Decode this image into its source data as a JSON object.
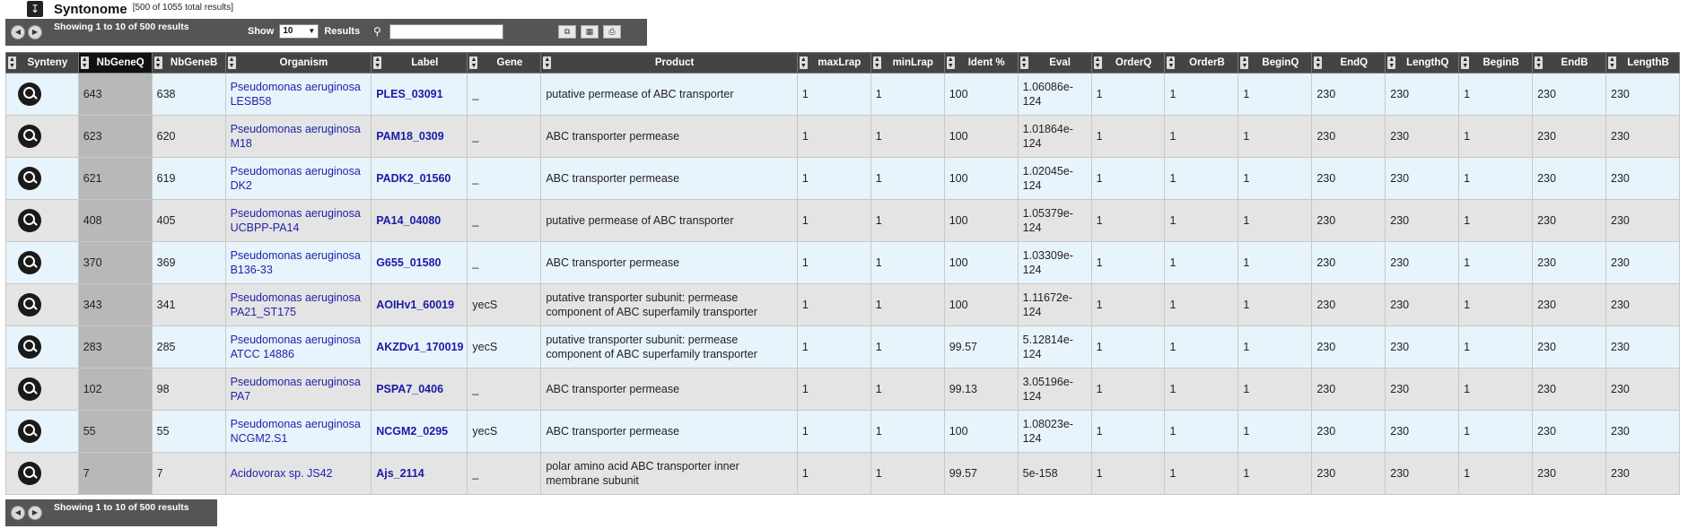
{
  "header": {
    "collapse_icon": "download-arrow-icon",
    "title": "Syntonome",
    "total": "[500 of 1055 total results]"
  },
  "toolbar": {
    "showing": "Showing 1 to 10 of 500 results",
    "show_label": "Show",
    "show_value": "10",
    "results_label": "Results",
    "search_placeholder": ""
  },
  "footer": {
    "showing": "Showing 1 to 10 of 500 results"
  },
  "columns": [
    "Synteny",
    "NbGeneQ",
    "NbGeneB",
    "Organism",
    "Label",
    "Gene",
    "Product",
    "maxLrap",
    "minLrap",
    "Ident %",
    "Eval",
    "OrderQ",
    "OrderB",
    "BeginQ",
    "EndQ",
    "LengthQ",
    "BeginB",
    "EndB",
    "LengthB"
  ],
  "rows": [
    {
      "nbq": "643",
      "nbb": "638",
      "org1": "Pseudomonas aeruginosa",
      "org2": "LESB58",
      "label": "PLES_03091",
      "gene": "_",
      "product": "putative permease of ABC transporter",
      "maxl": "1",
      "minl": "1",
      "ident": "100",
      "eval1": "1.06086e-",
      "eval2": "124",
      "oq": "1",
      "ob": "1",
      "bq": "1",
      "eq": "230",
      "lq": "230",
      "bb": "1",
      "eb": "230",
      "lb": "230"
    },
    {
      "nbq": "623",
      "nbb": "620",
      "org1": "Pseudomonas aeruginosa",
      "org2": "M18",
      "label": "PAM18_0309",
      "gene": "_",
      "product": "ABC transporter permease",
      "maxl": "1",
      "minl": "1",
      "ident": "100",
      "eval1": "1.01864e-",
      "eval2": "124",
      "oq": "1",
      "ob": "1",
      "bq": "1",
      "eq": "230",
      "lq": "230",
      "bb": "1",
      "eb": "230",
      "lb": "230"
    },
    {
      "nbq": "621",
      "nbb": "619",
      "org1": "Pseudomonas aeruginosa",
      "org2": "DK2",
      "label": "PADK2_01560",
      "gene": "_",
      "product": "ABC transporter permease",
      "maxl": "1",
      "minl": "1",
      "ident": "100",
      "eval1": "1.02045e-",
      "eval2": "124",
      "oq": "1",
      "ob": "1",
      "bq": "1",
      "eq": "230",
      "lq": "230",
      "bb": "1",
      "eb": "230",
      "lb": "230"
    },
    {
      "nbq": "408",
      "nbb": "405",
      "org1": "Pseudomonas aeruginosa",
      "org2": "UCBPP-PA14",
      "label": "PA14_04080",
      "gene": "_",
      "product": "putative permease of ABC transporter",
      "maxl": "1",
      "minl": "1",
      "ident": "100",
      "eval1": "1.05379e-",
      "eval2": "124",
      "oq": "1",
      "ob": "1",
      "bq": "1",
      "eq": "230",
      "lq": "230",
      "bb": "1",
      "eb": "230",
      "lb": "230"
    },
    {
      "nbq": "370",
      "nbb": "369",
      "org1": "Pseudomonas aeruginosa",
      "org2": "B136-33",
      "label": "G655_01580",
      "gene": "_",
      "product": "ABC transporter permease",
      "maxl": "1",
      "minl": "1",
      "ident": "100",
      "eval1": "1.03309e-",
      "eval2": "124",
      "oq": "1",
      "ob": "1",
      "bq": "1",
      "eq": "230",
      "lq": "230",
      "bb": "1",
      "eb": "230",
      "lb": "230"
    },
    {
      "nbq": "343",
      "nbb": "341",
      "org1": "Pseudomonas aeruginosa",
      "org2": "PA21_ST175",
      "label": "AOIHv1_60019",
      "gene": "yecS",
      "product": "putative transporter subunit: permease component of ABC superfamily transporter",
      "maxl": "1",
      "minl": "1",
      "ident": "100",
      "eval1": "1.11672e-",
      "eval2": "124",
      "oq": "1",
      "ob": "1",
      "bq": "1",
      "eq": "230",
      "lq": "230",
      "bb": "1",
      "eb": "230",
      "lb": "230"
    },
    {
      "nbq": "283",
      "nbb": "285",
      "org1": "Pseudomonas aeruginosa",
      "org2": "ATCC 14886",
      "label": "AKZDv1_170019",
      "gene": "yecS",
      "product": "putative transporter subunit: permease component of ABC superfamily transporter",
      "maxl": "1",
      "minl": "1",
      "ident": "99.57",
      "eval1": "5.12814e-",
      "eval2": "124",
      "oq": "1",
      "ob": "1",
      "bq": "1",
      "eq": "230",
      "lq": "230",
      "bb": "1",
      "eb": "230",
      "lb": "230"
    },
    {
      "nbq": "102",
      "nbb": "98",
      "org1": "Pseudomonas aeruginosa",
      "org2": "PA7",
      "label": "PSPA7_0406",
      "gene": "_",
      "product": "ABC transporter permease",
      "maxl": "1",
      "minl": "1",
      "ident": "99.13",
      "eval1": "3.05196e-",
      "eval2": "124",
      "oq": "1",
      "ob": "1",
      "bq": "1",
      "eq": "230",
      "lq": "230",
      "bb": "1",
      "eb": "230",
      "lb": "230"
    },
    {
      "nbq": "55",
      "nbb": "55",
      "org1": "Pseudomonas aeruginosa",
      "org2": "NCGM2.S1",
      "label": "NCGM2_0295",
      "gene": "yecS",
      "product": "ABC transporter permease",
      "maxl": "1",
      "minl": "1",
      "ident": "100",
      "eval1": "1.08023e-",
      "eval2": "124",
      "oq": "1",
      "ob": "1",
      "bq": "1",
      "eq": "230",
      "lq": "230",
      "bb": "1",
      "eb": "230",
      "lb": "230"
    },
    {
      "nbq": "7",
      "nbb": "7",
      "org1": "Acidovorax sp. JS42",
      "org2": "",
      "label": "Ajs_2114",
      "gene": "_",
      "product": "polar amino acid ABC transporter inner membrane subunit",
      "maxl": "1",
      "minl": "1",
      "ident": "99.57",
      "eval1": "5e-158",
      "eval2": "",
      "oq": "1",
      "ob": "1",
      "bq": "1",
      "eq": "230",
      "lq": "230",
      "bb": "1",
      "eb": "230",
      "lb": "230"
    }
  ]
}
